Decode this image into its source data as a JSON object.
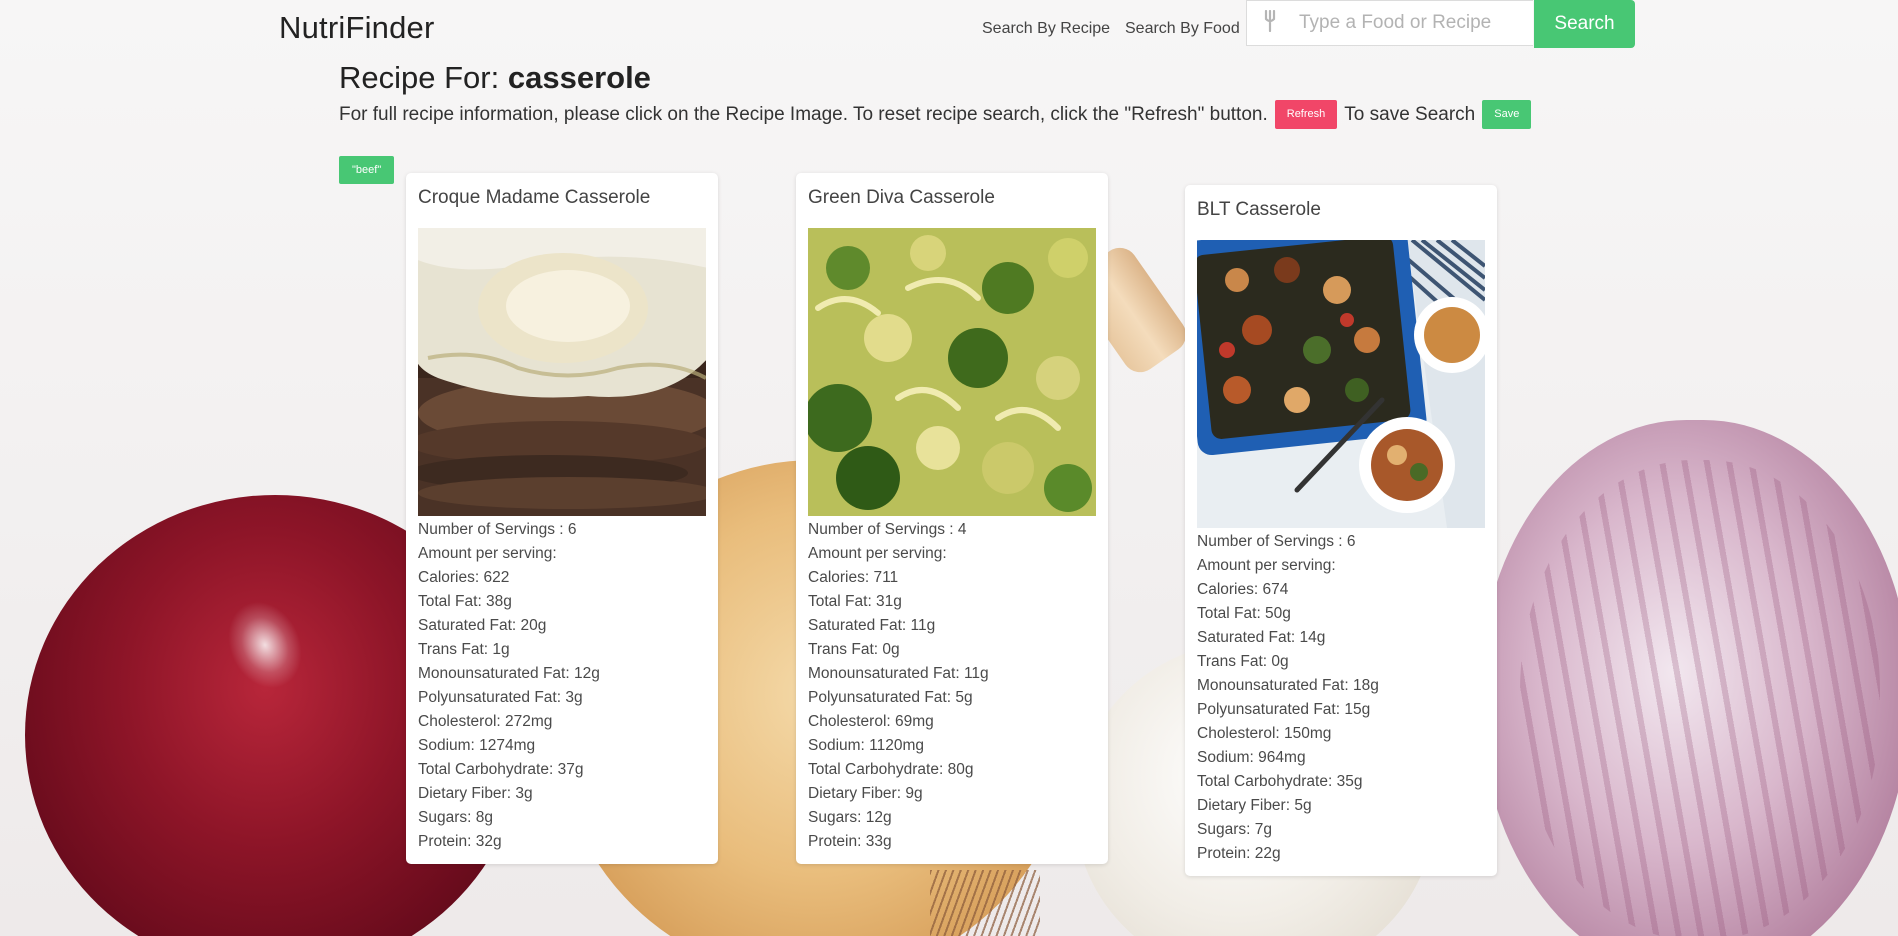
{
  "header": {
    "brand": "NutriFinder",
    "nav": {
      "search_by_recipe": "Search By Recipe",
      "search_by_food": "Search By Food"
    },
    "search": {
      "placeholder": "Type a Food or Recipe",
      "value": "",
      "button_label": "Search",
      "icon": "fork-icon"
    }
  },
  "title": {
    "prefix": "Recipe For:",
    "query": "casserole"
  },
  "info": {
    "text": "For full recipe information, please click on the Recipe Image. To reset recipe search, click the \"Refresh\" button.",
    "refresh_label": "Refresh",
    "save_text": "To save Search",
    "save_label": "Save"
  },
  "saved_tags": [
    "\"beef\""
  ],
  "colors": {
    "green": "#48c774",
    "red": "#f14668"
  },
  "recipes": [
    {
      "name": "Croque Madame Casserole",
      "facts": [
        "Number of Servings : 6",
        "Amount per serving:",
        "Calories: 622",
        "Total Fat: 38g",
        "Saturated Fat: 20g",
        "Trans Fat: 1g",
        "Monounsaturated Fat: 12g",
        "Polyunsaturated Fat: 3g",
        "Cholesterol: 272mg",
        "Sodium: 1274mg",
        "Total Carbohydrate: 37g",
        "Dietary Fiber: 3g",
        "Sugars: 8g",
        "Protein: 32g"
      ]
    },
    {
      "name": "Green Diva Casserole",
      "facts": [
        "Number of Servings : 4",
        "Amount per serving:",
        "Calories: 711",
        "Total Fat: 31g",
        "Saturated Fat: 11g",
        "Trans Fat: 0g",
        "Monounsaturated Fat: 11g",
        "Polyunsaturated Fat: 5g",
        "Cholesterol: 69mg",
        "Sodium: 1120mg",
        "Total Carbohydrate: 80g",
        "Dietary Fiber: 9g",
        "Sugars: 12g",
        "Protein: 33g"
      ]
    },
    {
      "name": "BLT Casserole",
      "facts": [
        "Number of Servings : 6",
        "Amount per serving:",
        "Calories: 674",
        "Total Fat: 50g",
        "Saturated Fat: 14g",
        "Trans Fat: 0g",
        "Monounsaturated Fat: 18g",
        "Polyunsaturated Fat: 15g",
        "Cholesterol: 150mg",
        "Sodium: 964mg",
        "Total Carbohydrate: 35g",
        "Dietary Fiber: 5g",
        "Sugars: 7g",
        "Protein: 22g"
      ]
    }
  ]
}
